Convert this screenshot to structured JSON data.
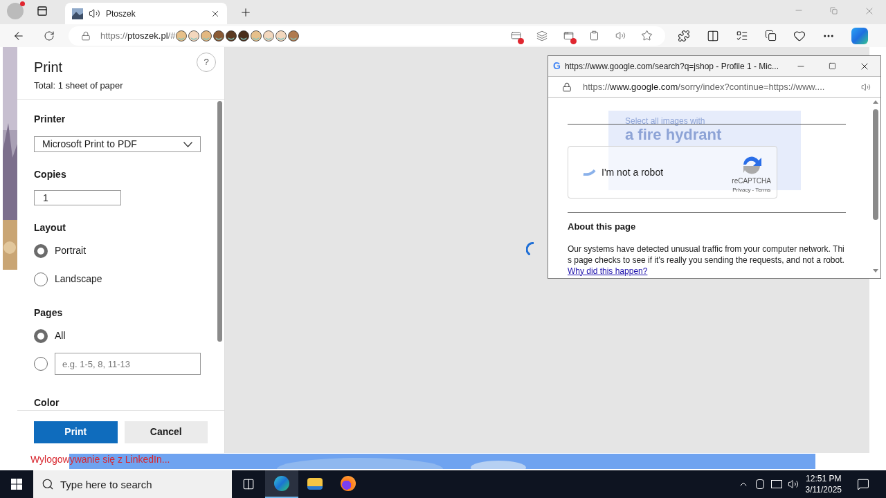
{
  "browser": {
    "tabs": [
      {
        "title": "Ptoszek",
        "selected": true
      }
    ],
    "address": {
      "scheme": "https://",
      "host": "ptoszek.pl",
      "path": "/#"
    }
  },
  "print_dialog": {
    "title": "Print",
    "summary": "Total: 1 sheet of paper",
    "help": "?",
    "printer": {
      "label": "Printer",
      "value": "Microsoft Print to PDF"
    },
    "copies": {
      "label": "Copies",
      "value": "1"
    },
    "layout": {
      "label": "Layout",
      "options": [
        {
          "label": "Portrait",
          "selected": true
        },
        {
          "label": "Landscape",
          "selected": false
        }
      ]
    },
    "pages": {
      "label": "Pages",
      "options": [
        {
          "kind": "label",
          "label": "All",
          "selected": true
        },
        {
          "kind": "range",
          "placeholder": "e.g. 1-5, 8, 11-13",
          "selected": false
        }
      ]
    },
    "color": {
      "label": "Color"
    },
    "buttons": [
      {
        "label": "Print",
        "kind": "primary"
      },
      {
        "label": "Cancel",
        "kind": "secondary"
      }
    ]
  },
  "page_footer": {
    "link": "Wylogowywanie się z LinkedIn..."
  },
  "popup": {
    "icon": "G",
    "title": "https://www.google.com/search?q=jshop - Profile 1 - Mic...",
    "address": {
      "scheme": "https://",
      "host": "www.google.com",
      "path": "/sorry/index?continue=https://www...."
    },
    "challenge": {
      "prompt": "Select all images with",
      "target": "a fire hydrant"
    },
    "captcha": {
      "label": "I'm not a robot",
      "brand": "reCAPTCHA",
      "links": "Privacy - Terms"
    },
    "about": {
      "heading": "About this page",
      "text": "Our systems have detected unusual traffic from your computer network. This page checks to see if it's really you sending the requests, and not a robot.",
      "link": "Why did this happen?"
    }
  },
  "taskbar": {
    "search_placeholder": "Type here to search",
    "apps": [
      {
        "kind": "edge",
        "selected": true
      },
      {
        "kind": "folder",
        "selected": false
      },
      {
        "kind": "firefox",
        "selected": false
      }
    ],
    "time": "12:51 PM",
    "date": "3/11/2025"
  }
}
